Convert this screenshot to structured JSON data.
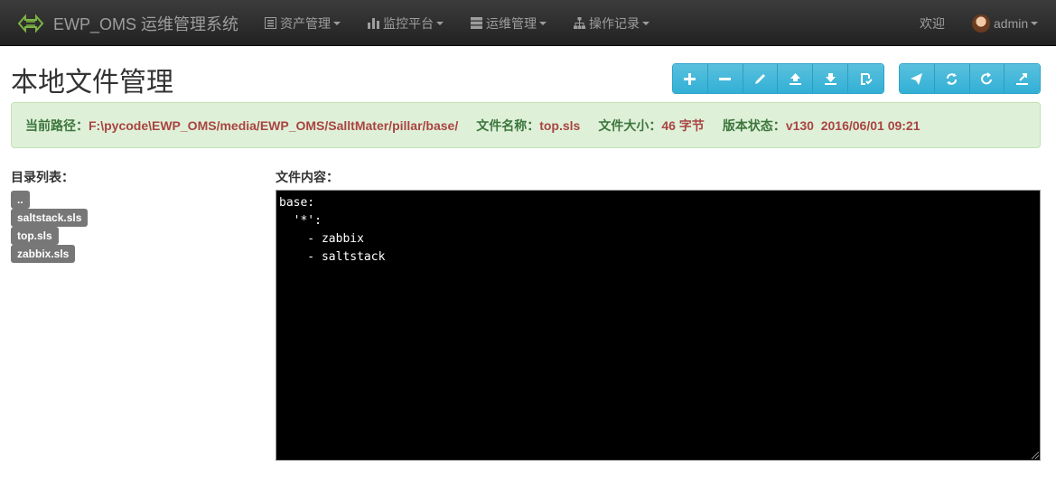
{
  "navbar": {
    "brand": "EWP_OMS 运维管理系统",
    "menus": [
      {
        "label": "资产管理",
        "icon": "list-alt-icon"
      },
      {
        "label": "监控平台",
        "icon": "bar-chart-icon"
      },
      {
        "label": "运维管理",
        "icon": "server-icon"
      },
      {
        "label": "操作记录",
        "icon": "sitemap-icon"
      }
    ],
    "welcome": "欢迎",
    "user": "admin"
  },
  "page": {
    "title": "本地文件管理"
  },
  "toolbar": {
    "group1": [
      "plus-icon",
      "minus-icon",
      "pencil-icon",
      "upload-icon",
      "download-icon",
      "save-check-icon"
    ],
    "group2": [
      "send-icon",
      "sync-icon",
      "refresh-icon",
      "export-icon"
    ],
    "color": "#5bc0de"
  },
  "info": {
    "path_label": "当前路径：",
    "path_value": "F:\\pycode\\EWP_OMS/media/EWP_OMS/SalltMater/pillar/base/",
    "name_label": "文件名称：",
    "name_value": "top.sls",
    "size_label": "文件大小：",
    "size_value": "46 字节",
    "version_label": "版本状态：",
    "version_value": "v130  2016/06/01 09:21"
  },
  "dir": {
    "title": "目录列表：",
    "items": [
      "..",
      "saltstack.sls",
      "top.sls",
      "zabbix.sls"
    ]
  },
  "content": {
    "title": "文件内容：",
    "lines": [
      "base:",
      "  '*':",
      "    - zabbix",
      "    - saltstack"
    ]
  }
}
